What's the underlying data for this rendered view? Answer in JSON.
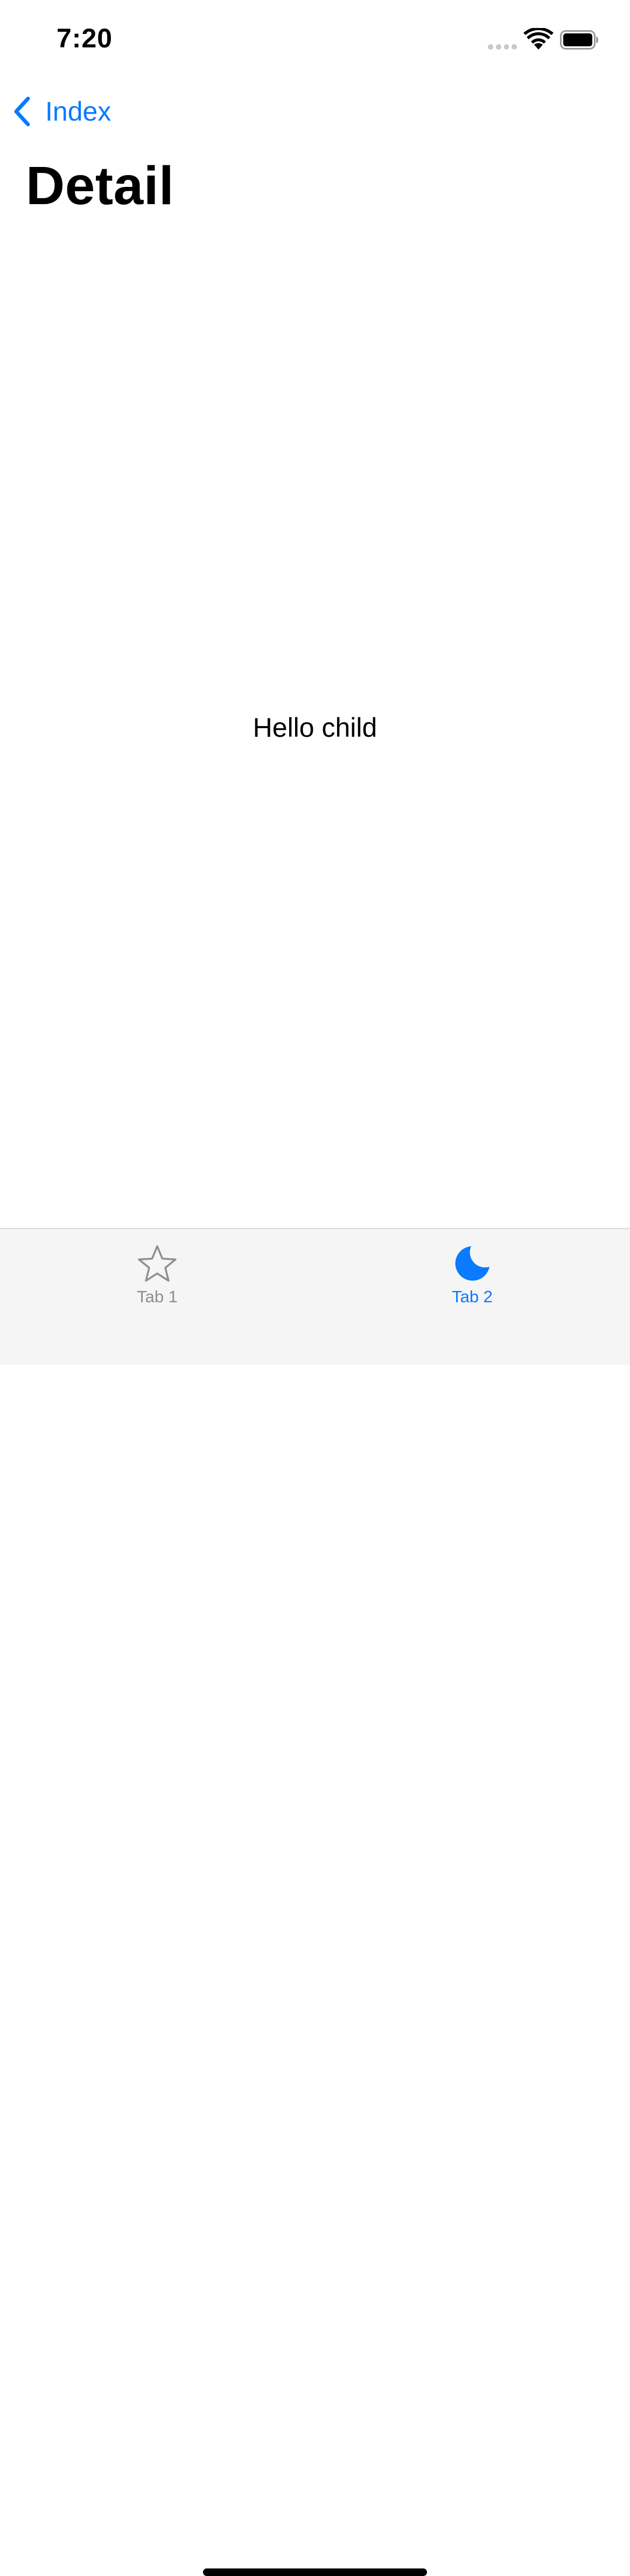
{
  "status_bar": {
    "time": "7:20",
    "signal_icon": "cellular-signal-icon",
    "wifi_icon": "wifi-icon",
    "battery_icon": "battery-icon"
  },
  "nav": {
    "back_label": "Index",
    "back_icon": "chevron-left-icon",
    "title": "Detail"
  },
  "content": {
    "text": "Hello child"
  },
  "tab_bar": {
    "tabs": [
      {
        "label": "Tab 1",
        "icon": "star-icon",
        "selected": false
      },
      {
        "label": "Tab 2",
        "icon": "moon-icon",
        "selected": true
      }
    ]
  },
  "colors": {
    "accent": "#0a7aff",
    "inactive_tab": "#8e8e93",
    "tab_bar_background": "#f5f5f5"
  }
}
